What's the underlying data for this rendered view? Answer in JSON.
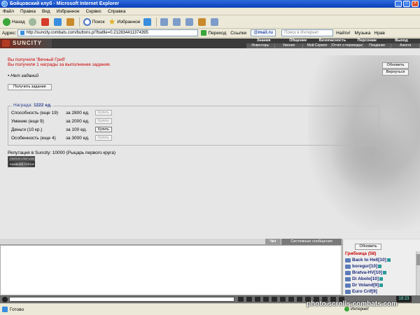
{
  "window": {
    "title": "Бойцовский клуб - Microsoft Internet Explorer"
  },
  "menu": [
    "Файл",
    "Правка",
    "Вид",
    "Избранное",
    "Сервис",
    "Справка"
  ],
  "toolbar": {
    "back": "Назад",
    "search": "Поиск",
    "favorites": "Избранное"
  },
  "address": {
    "label": "Адрес:",
    "url": "http://suncity.combats.com/buttons.pl?battle=0.212834411374395",
    "go": "Переход",
    "links": "Ссылки",
    "mailru": "@mail.ru",
    "search_placeholder": "Поиск в Интернет",
    "find": "Найти!",
    "music": "Музыка",
    "nrav": "Нрав"
  },
  "game": {
    "logo": "SUNCITY",
    "nav_top": [
      "Знания",
      "Общение",
      "Безопасность",
      "Персонаж",
      "Выход"
    ],
    "nav_bottom": [
      "Инвентарь",
      "Умения",
      "Мой Сервлл",
      "Отчет о переводах",
      "Поединки",
      "Анкета"
    ]
  },
  "content": {
    "message1": "Вы получили 'Вечный Гриб'",
    "message2": "Вы получили 1 награды за выполнение задания.",
    "no_quests": "Нет заданий",
    "get_quest": "Получить задание",
    "refresh": "Обновить",
    "return": "Вернуться",
    "reward_label": "Награда:",
    "reward_value": "1222 ед.",
    "rewards": [
      {
        "name": "Способность (еще 19)",
        "price": "за 2800 ед.",
        "buy": "Купить",
        "active": false
      },
      {
        "name": "Умение (еще 9)",
        "price": "за 2000 ед.",
        "buy": "Купить",
        "active": false
      },
      {
        "name": "Деньги (10 кр.)",
        "price": "за 100 ед.",
        "buy": "Купить",
        "active": true
      },
      {
        "name": "Особенность (еще 4)",
        "price": "за 3000 ед.",
        "buy": "Купить",
        "active": false
      }
    ],
    "reputation": "Репутация в Suncity: 10000 (Рыцарь первого круга)",
    "counter_top": "FESTIVE 17547 1046",
    "counter_bottom": "RAMBLER TOP100"
  },
  "chat": {
    "tab_chat": "Чат",
    "tab_system": "Системные сообщения"
  },
  "online": {
    "refresh": "Обновить",
    "room": "Грибница (58)",
    "players": [
      {
        "name": "Back to Hell",
        "level": "[10]"
      },
      {
        "name": "boregur",
        "level": "[10]"
      },
      {
        "name": "Bratva-HV",
        "level": "[10]"
      },
      {
        "name": "Di Abolo",
        "level": "[10]"
      },
      {
        "name": "Dr Voland",
        "level": "[9]"
      },
      {
        "name": "Euro Crif",
        "level": "[9]"
      }
    ]
  },
  "clock": "18:23",
  "status": {
    "text": "Готово",
    "zone": "Интернет"
  },
  "watermark": "photo.scrolls.combats.com"
}
